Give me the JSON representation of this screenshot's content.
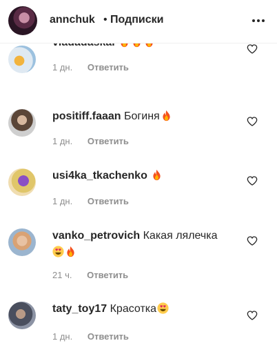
{
  "header": {
    "username": "annchuk",
    "separator": "•",
    "follow_label": "Подписки"
  },
  "comments": [
    {
      "username": "vladadaskal",
      "text": "",
      "emojis": [
        "fire-icon",
        "fire-icon",
        "fire-icon"
      ],
      "time": "1 дн.",
      "reply": "Ответить"
    },
    {
      "username": "positiff.faaan",
      "text": "Богиня",
      "emojis": [
        "fire-icon"
      ],
      "time": "1 дн.",
      "reply": "Ответить"
    },
    {
      "username": "usi4ka_tkachenko",
      "text": "",
      "emojis": [
        "fire-icon"
      ],
      "time": "1 дн.",
      "reply": "Ответить"
    },
    {
      "username": "vanko_petrovich",
      "text": "Какая лялечка",
      "emojis": [
        "heart-eyes-icon",
        "fire-icon"
      ],
      "time": "21 ч.",
      "reply": "Ответить"
    },
    {
      "username": "taty_toy17",
      "text": "Красотка",
      "emojis": [
        "heart-eyes-icon"
      ],
      "time": "1 дн.",
      "reply": "Ответить"
    }
  ],
  "colors": {
    "text": "#262626",
    "meta": "#8e8e8e",
    "divider": "#efefef"
  }
}
